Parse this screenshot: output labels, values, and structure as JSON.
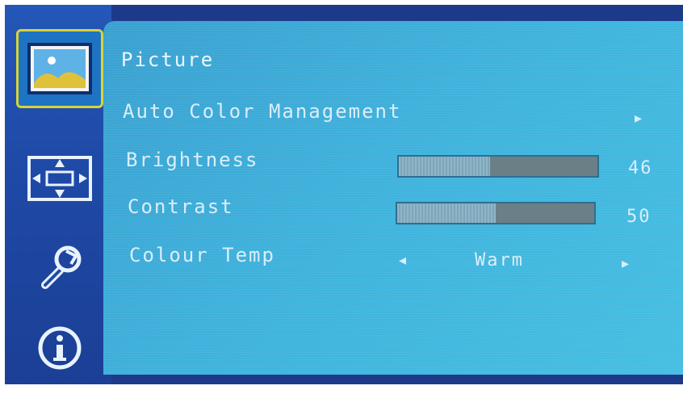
{
  "menu": {
    "title": "Picture",
    "items": [
      {
        "label": "Auto Color Management",
        "arrow": "▸"
      },
      {
        "label": "Brightness",
        "value": "46",
        "level": 0.46
      },
      {
        "label": "Contrast",
        "value": "50",
        "level": 0.5
      },
      {
        "label": "Colour Temp",
        "left_arrow": "◂",
        "value": "Warm",
        "right_arrow": "▸"
      }
    ]
  },
  "sidebar": {
    "icons": [
      "picture-icon",
      "screen-position-icon",
      "settings-wrench-icon",
      "info-icon"
    ],
    "active": "picture-icon"
  },
  "colors": {
    "panel": "#3fb2dc",
    "sidebar": "#1f4aa8",
    "active_border": "#d8d23a"
  }
}
